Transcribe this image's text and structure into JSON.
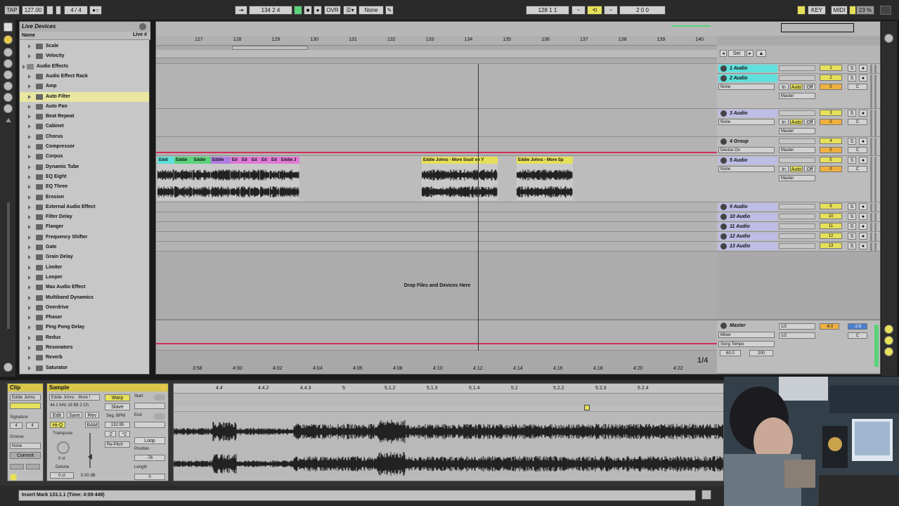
{
  "topbar": {
    "tap": "TAP",
    "tempo": "127.00",
    "sig": "4 / 4",
    "quant": "OVR",
    "position": "134  2  4",
    "none_label": "None",
    "loop_start": "128  1  1",
    "loop_len": "2  0  0",
    "key": "KEY",
    "midi": "MIDI",
    "cpu": "23 %"
  },
  "browser": {
    "title": "Live Devices",
    "col_name": "Name",
    "col_live": "Live #",
    "items": [
      "Scale",
      "Velocity",
      "Audio Effects",
      "Audio Effect Rack",
      "Amp",
      "Auto Filter",
      "Auto Pan",
      "Beat Repeat",
      "Cabinet",
      "Chorus",
      "Compressor",
      "Corpus",
      "Dynamic Tube",
      "EQ Eight",
      "EQ Three",
      "Erosion",
      "External Audio Effect",
      "Filter Delay",
      "Flanger",
      "Frequency Shifter",
      "Gate",
      "Grain Delay",
      "Limiter",
      "Looper",
      "Max Audio Effect",
      "Multiband Dynamics",
      "Overdrive",
      "Phaser",
      "Ping Pong Delay",
      "Redux",
      "Resonators",
      "Reverb",
      "Saturator"
    ]
  },
  "ruler_top": [
    "127",
    "128",
    "129",
    "130",
    "131",
    "132",
    "133",
    "134",
    "135",
    "136",
    "137",
    "138",
    "139",
    "140"
  ],
  "ruler_bottom": [
    "3:58",
    "4:00",
    "4:02",
    "4:04",
    "4:06",
    "4:08",
    "4:10",
    "4:12",
    "4:14",
    "4:16",
    "4:18",
    "4:20",
    "4:22"
  ],
  "arrangement": {
    "set_label": "Set",
    "drop_text": "Drop Files and Devices Here",
    "page": "1/4",
    "clips_small": [
      "Eddi",
      "Eddie",
      "Eddie",
      "Eddie",
      "Ed",
      "Ed",
      "Ed",
      "Ed",
      "Ed",
      "Eddie J"
    ],
    "clip_a": "Eddie Johns - More Soul! on Y",
    "clip_b": "Eddie Johns - More Sp"
  },
  "tracks": [
    {
      "name": "1 Audio",
      "num": "1"
    },
    {
      "name": "2 Audio",
      "num": "2"
    },
    {
      "name": "3 Audio",
      "num": "3"
    },
    {
      "name": "4 Group",
      "num": "4"
    },
    {
      "name": "5 Audio",
      "num": "5"
    },
    {
      "name": "9 Audio",
      "num": "9"
    },
    {
      "name": "10 Audio",
      "num": "10"
    },
    {
      "name": "11 Audio",
      "num": "11"
    },
    {
      "name": "12 Audio",
      "num": "12"
    },
    {
      "name": "13 Audio",
      "num": "13"
    }
  ],
  "mixer": {
    "none": "None",
    "master": "Master",
    "device_on": "Device On",
    "ext_in": "Ext. In",
    "in": "In",
    "auto": "Auto",
    "off": "Off",
    "ch_1_2": "1/2",
    "zero": "0",
    "c": "C",
    "s": "S",
    "master_name": "Master",
    "mixer_label": "Mixer",
    "song_tempo": "Song Tempo",
    "t1": "60.0",
    "t2": "200",
    "master_vol": "-8.0",
    "master_peak": "-2.8"
  },
  "clip_panel": {
    "title": "Clip",
    "name": "Eddie Johns",
    "signature": "Signature",
    "sig_a": "4",
    "sig_b": "4",
    "groove": "Groove",
    "groove_val": "None",
    "commit": "Commit"
  },
  "sample_panel": {
    "title": "Sample",
    "name": "Eddie Johns - More !",
    "info": "44.1 kHz 16 Bit 2 Ch",
    "edit": "Edit",
    "save": "Save",
    "rev": "Rev",
    "hiq": "Hi-Q",
    "ram": "RAM",
    "warp": "Warp",
    "slave": "Slave",
    "seg_bpm": "Seg. BPM",
    "bpm": "132.95",
    "half": ":2",
    "double": "*2",
    "mode": "Re-Pitch",
    "transpose": "Transpose",
    "st": "0 st",
    "detune": "Detune",
    "ct": "0 ct",
    "db": "0.00 dB",
    "start": "Start",
    "end": "End",
    "loop": "Loop",
    "position": "Position",
    "length": "Length",
    "pos_val": "-76",
    "len_val": "0"
  },
  "sample_ruler": [
    "4.4",
    "4.4.2",
    "4.4.3",
    "5",
    "5.1.2",
    "5.1.3",
    "5.1.4",
    "5.2",
    "5.2.2",
    "5.2.3",
    "5.2.4"
  ],
  "status": "Insert Mark 133.1.1 (Time: 4:09:449)",
  "colors": {
    "cyan": "#5fe0dc",
    "green": "#5ad37a",
    "purple": "#b07de0",
    "magenta": "#e07ad6",
    "yellow": "#e6e05a",
    "orange": "#f0b040",
    "red": "#d4305a"
  }
}
